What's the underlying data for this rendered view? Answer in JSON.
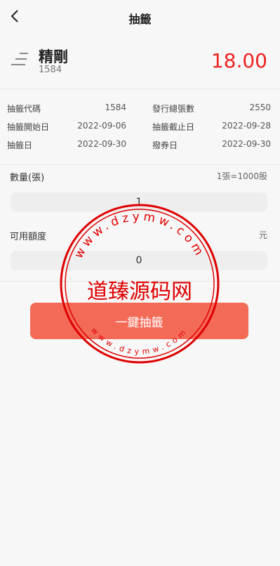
{
  "header": {
    "title": "抽籤"
  },
  "stock": {
    "name": "精剛",
    "code": "1584",
    "price": "18.00"
  },
  "info": {
    "rows": [
      {
        "left_label": "抽籤代碼",
        "left_value": "1584",
        "right_label": "發行總張數",
        "right_value": "2550"
      },
      {
        "left_label": "抽籤開始日",
        "left_value": "2022-09-06",
        "right_label": "抽籤截止日",
        "right_value": "2022-09-28"
      },
      {
        "left_label": "抽籤日",
        "left_value": "2022-09-30",
        "right_label": "撥券日",
        "right_value": "2022-09-30"
      }
    ]
  },
  "quantity": {
    "label": "數量(張)",
    "hint": "1張=1000股",
    "value": "1"
  },
  "amount": {
    "label": "可用額度",
    "unit": "元",
    "value": "0"
  },
  "button": {
    "label": "一鍵抽籤"
  },
  "watermark": {
    "center_text": "道臻源码网",
    "ring_top": "www.dzymw.com",
    "ring_bottom": "www.dzymw.com",
    "color": "#e00000"
  },
  "colors": {
    "price": "#e22222",
    "button": "#f36a57",
    "background": "#f7f7f7"
  }
}
